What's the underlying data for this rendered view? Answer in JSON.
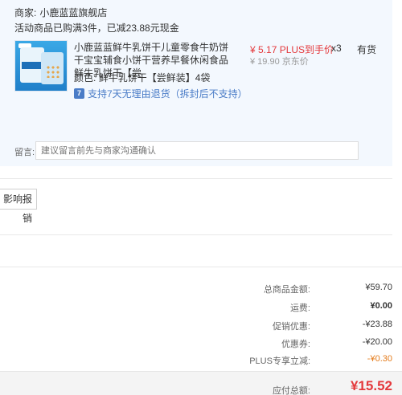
{
  "shop": {
    "label": "商家:",
    "name": "小鹿蓝蓝旗舰店"
  },
  "promo": {
    "text": "活动商品已购满3件，已减23.88元现金"
  },
  "item": {
    "title": "小鹿蓝蓝鲜牛乳饼干儿童零食牛奶饼干宝宝辅食小饼干营养早餐休闲食品 鲜牛乳饼干【尝",
    "color_label": "颜色:",
    "color_value": "鲜牛乳饼干【尝鲜装】4袋",
    "return_icon": "7",
    "return_policy": "支持7天无理由退货（拆封后不支持）",
    "price": "¥ 5.17 PLUS到手价",
    "original_price": "¥ 19.90 京东价",
    "quantity": "x3",
    "stock": "有货"
  },
  "remark": {
    "label": "留言:",
    "placeholder": "建议留言前先与商家沟通确认"
  },
  "invoice": {
    "button_label": "影响报销"
  },
  "summary": [
    {
      "label": "总商品金额:",
      "value": "¥59.70"
    },
    {
      "label": "运费:",
      "value": "¥0.00"
    },
    {
      "label": "促销优惠:",
      "value": "-¥23.88"
    },
    {
      "label": "优惠券:",
      "value": "-¥20.00"
    },
    {
      "label": "PLUS专享立减:",
      "value": "-¥0.30"
    }
  ],
  "total": {
    "label": "应付总额:",
    "value": "¥15.52"
  },
  "colors": {
    "block_bg": "#f3f8fe",
    "price_red": "#e4393c",
    "link_blue": "#4a7cc7",
    "plus_orange": "#e47b1a"
  }
}
